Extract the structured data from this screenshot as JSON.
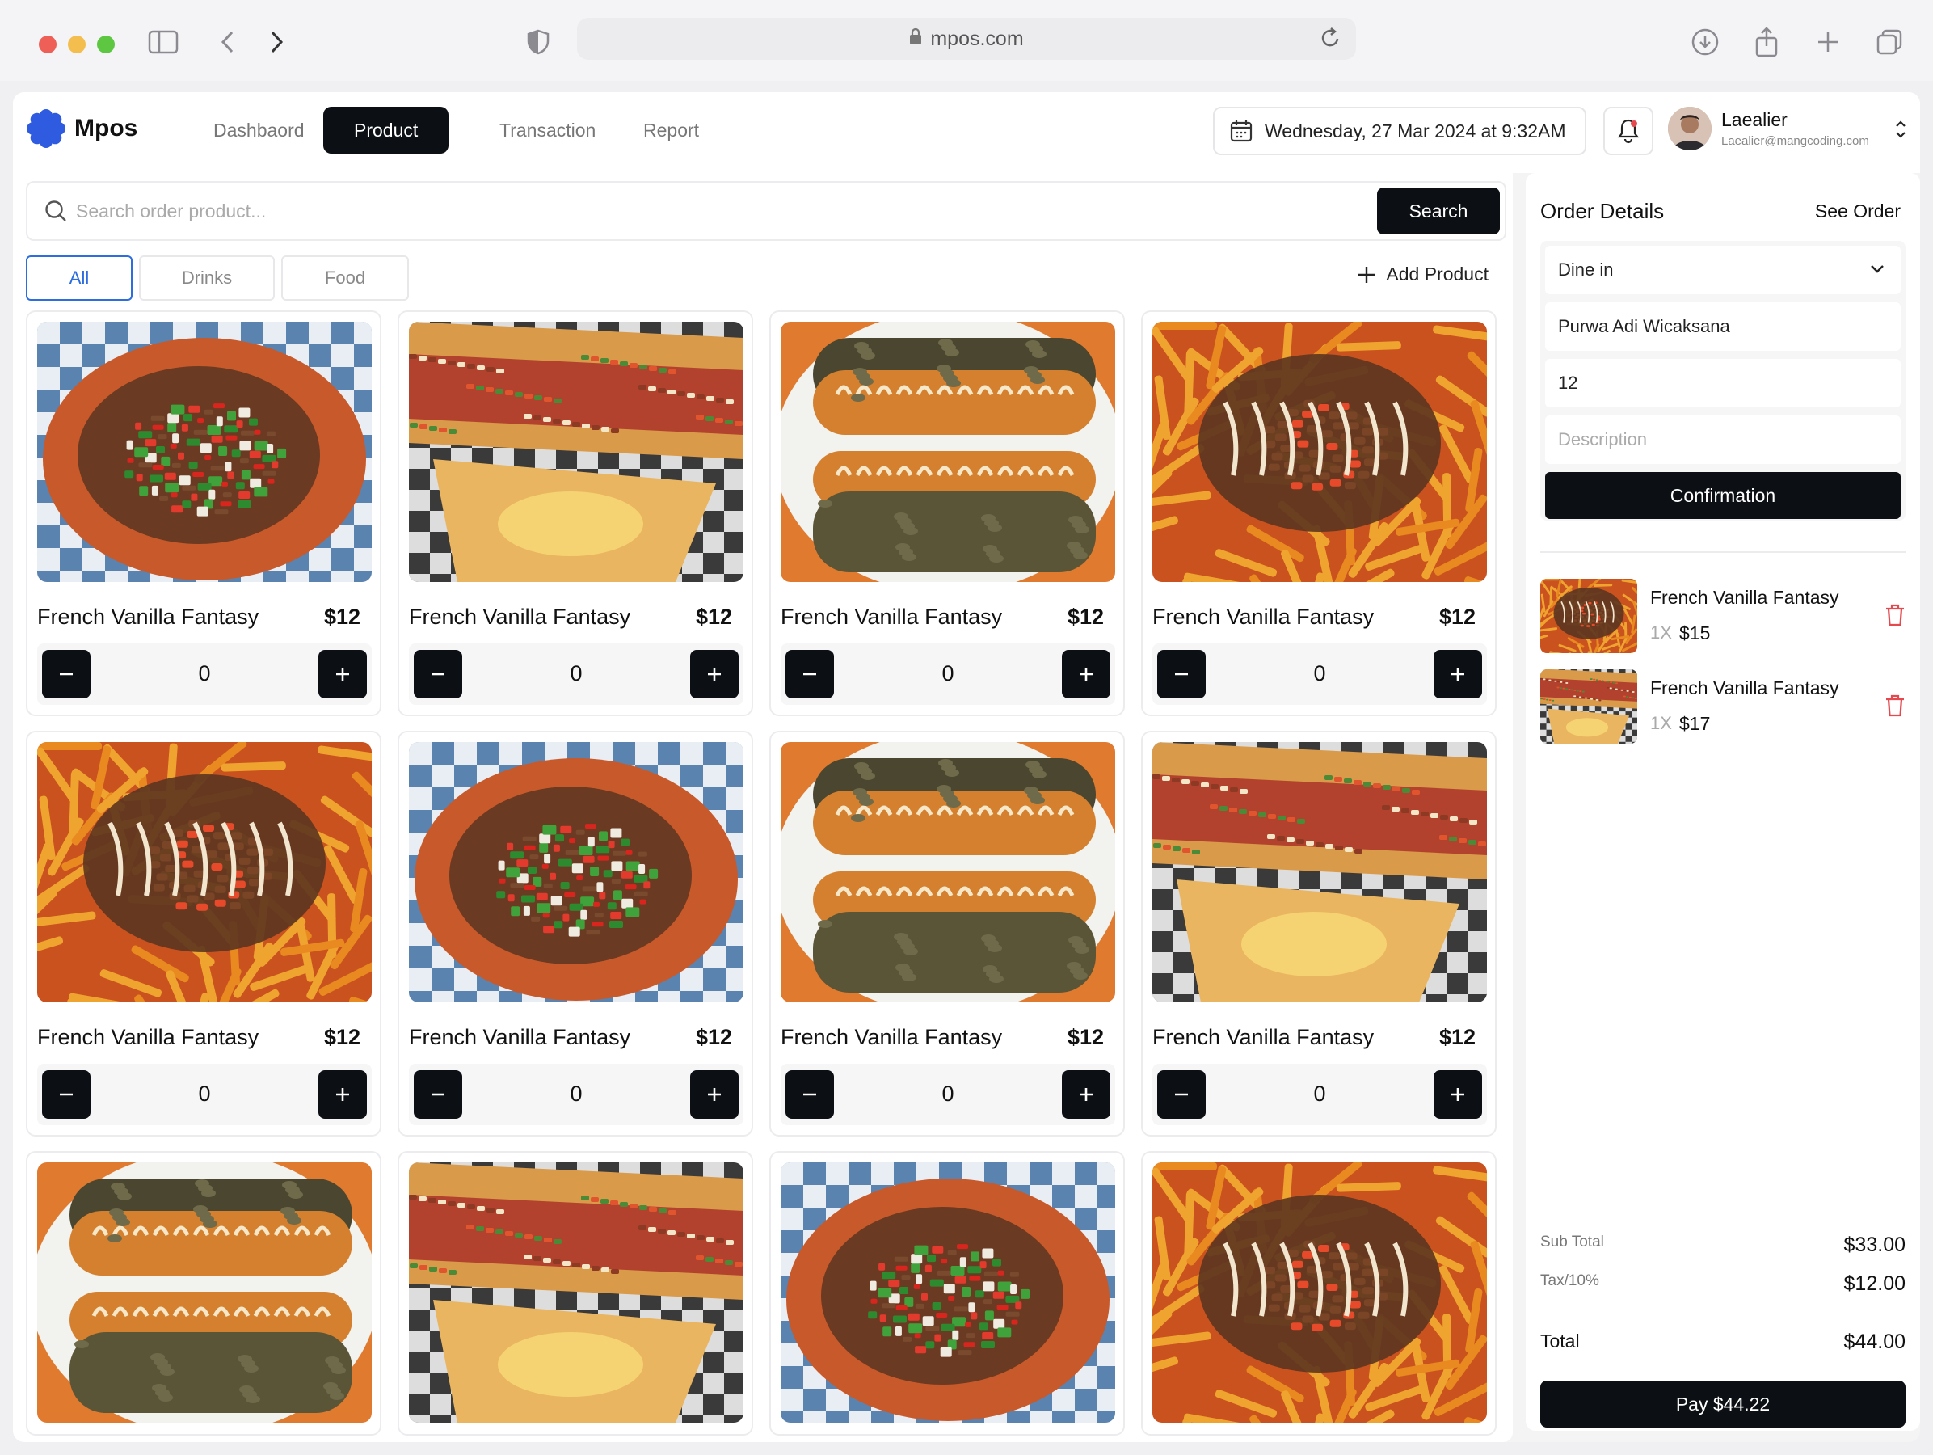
{
  "browser": {
    "url": "mpos.com"
  },
  "app": {
    "brand": "Mpos",
    "nav": [
      {
        "label": "Dashbaord",
        "active": false
      },
      {
        "label": "Product",
        "active": true
      },
      {
        "label": "Transaction",
        "active": false
      },
      {
        "label": "Report",
        "active": false
      }
    ],
    "datetime": "Wednesday, 27 Mar 2024 at 9:32AM",
    "user": {
      "name": "Laealier",
      "email": "Laealier@mangcoding.com"
    }
  },
  "search": {
    "placeholder": "Search order product...",
    "button_label": "Search"
  },
  "filters": [
    {
      "label": "All",
      "active": true
    },
    {
      "label": "Drinks",
      "active": false
    },
    {
      "label": "Food",
      "active": false
    }
  ],
  "add_product_label": "Add Product",
  "products": [
    {
      "name": "French Vanilla Fantasy",
      "price": "$12",
      "qty": "0",
      "image": "nachos"
    },
    {
      "name": "French Vanilla Fantasy",
      "price": "$12",
      "qty": "0",
      "image": "quesadilla"
    },
    {
      "name": "French Vanilla Fantasy",
      "price": "$12",
      "qty": "0",
      "image": "cheesesteak"
    },
    {
      "name": "French Vanilla Fantasy",
      "price": "$12",
      "qty": "0",
      "image": "fries"
    },
    {
      "name": "French Vanilla Fantasy",
      "price": "$12",
      "qty": "0",
      "image": "fries"
    },
    {
      "name": "French Vanilla Fantasy",
      "price": "$12",
      "qty": "0",
      "image": "nachos"
    },
    {
      "name": "French Vanilla Fantasy",
      "price": "$12",
      "qty": "0",
      "image": "cheesesteak"
    },
    {
      "name": "French Vanilla Fantasy",
      "price": "$12",
      "qty": "0",
      "image": "quesadilla"
    },
    {
      "name": "",
      "price": "",
      "qty": "",
      "image": "cheesesteak"
    },
    {
      "name": "",
      "price": "",
      "qty": "",
      "image": "quesadilla"
    },
    {
      "name": "",
      "price": "",
      "qty": "",
      "image": "nachos"
    },
    {
      "name": "",
      "price": "",
      "qty": "",
      "image": "fries"
    }
  ],
  "order": {
    "title": "Order Details",
    "see_order": "See Order",
    "type": "Dine in",
    "customer": "Purwa Adi Wicaksana",
    "table": "12",
    "description_placeholder": "Description",
    "confirm_label": "Confirmation",
    "items": [
      {
        "name": "French Vanilla Fantasy",
        "qty": "1X",
        "price": "$15",
        "image": "fries"
      },
      {
        "name": "French Vanilla Fantasy",
        "qty": "1X",
        "price": "$17",
        "image": "quesadilla"
      }
    ],
    "subtotal_label": "Sub Total",
    "subtotal": "$33.00",
    "tax_label": "Tax/10%",
    "tax": "$12.00",
    "total_label": "Total",
    "total": "$44.00",
    "pay_label": "Pay $44.22"
  },
  "colors": {
    "primary": "#0c0f14",
    "accent_blue": "#2c6de0",
    "delete_red": "#e5484d",
    "brand_logo": "#2f5be0"
  }
}
